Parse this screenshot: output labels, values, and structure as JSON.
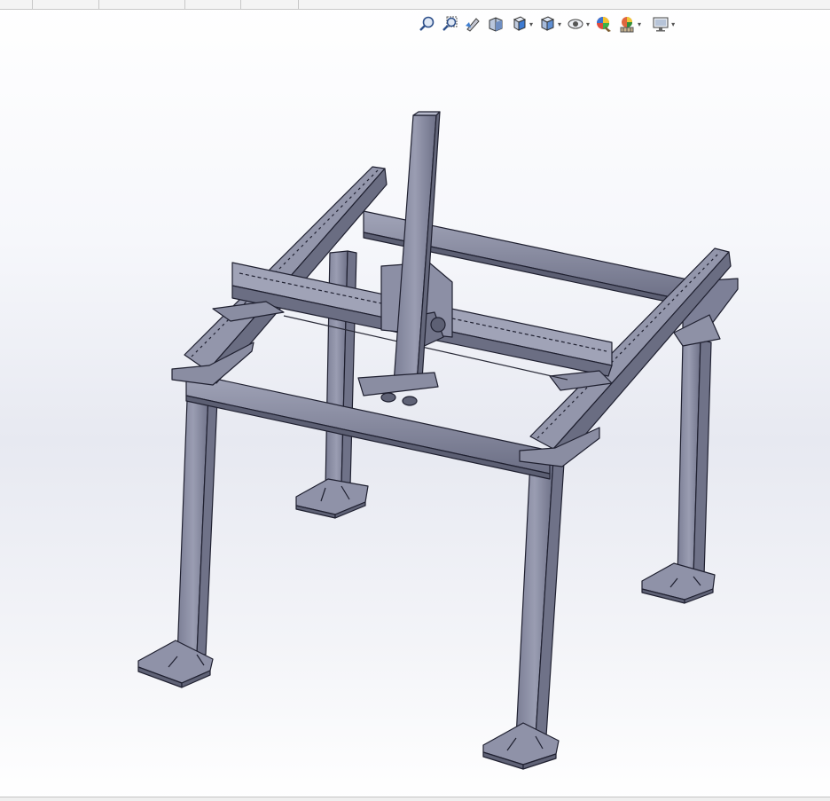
{
  "window": {
    "tabs": [
      "",
      "",
      "",
      "",
      "",
      ""
    ]
  },
  "toolbar": {
    "buttons": [
      {
        "icon": "zoom-to-fit-icon",
        "caret": false
      },
      {
        "icon": "zoom-to-area-icon",
        "caret": false
      },
      {
        "icon": "previous-view-icon",
        "caret": false
      },
      {
        "icon": "section-view-icon",
        "caret": false
      },
      {
        "icon": "view-orientation-icon",
        "caret": true
      },
      {
        "icon": "display-style-icon",
        "caret": true
      },
      {
        "icon": "hide-show-items-icon",
        "caret": true
      },
      {
        "icon": "edit-appearance-icon",
        "caret": false
      },
      {
        "icon": "apply-scene-icon",
        "caret": true
      },
      {
        "icon": "view-settings-icon",
        "caret": true
      }
    ],
    "caret_glyph": "▾"
  },
  "model": {
    "description_colors": {
      "steel": "#8a8da3",
      "steel_dark": "#6a6d82",
      "steel_light": "#a7aabe",
      "edge": "#1e1f29"
    }
  }
}
